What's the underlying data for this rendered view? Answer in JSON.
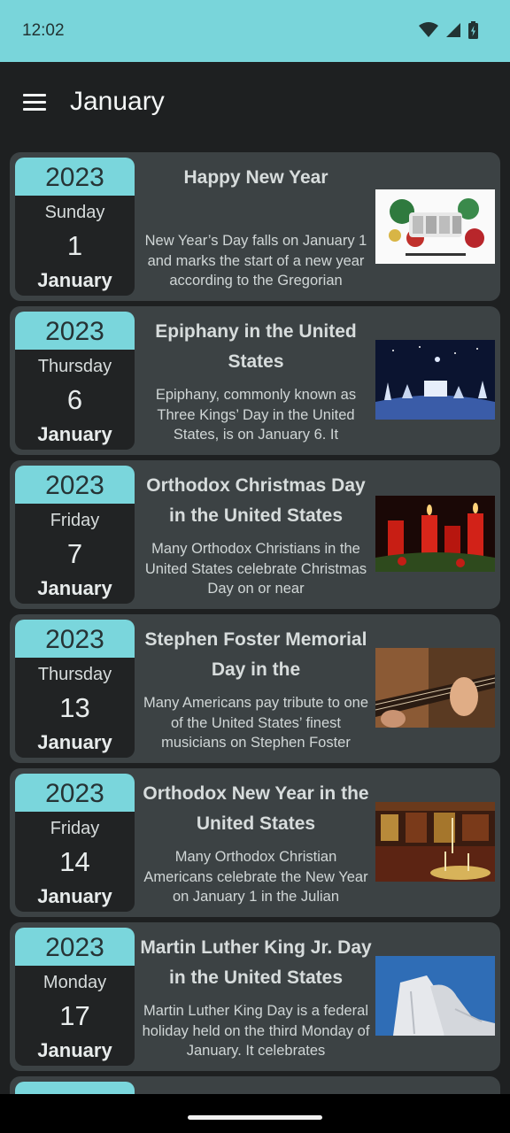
{
  "status_bar": {
    "time": "12:02",
    "icons": [
      "wifi-icon",
      "signal-icon",
      "battery-icon"
    ]
  },
  "app_bar": {
    "title": "January",
    "menu_icon": "hamburger-menu-icon"
  },
  "colors": {
    "accent": "#7ad6dc",
    "card_bg": "#3c4244",
    "background": "#1e2021"
  },
  "events": [
    {
      "year": "2023",
      "weekday": "Sunday",
      "day": "1",
      "month": "January",
      "title": "Happy New Year",
      "description": "New Year’s Day falls on January 1 and marks the start of a new year according to the Gregorian",
      "image": "new-year-2022-image"
    },
    {
      "year": "2023",
      "weekday": "Thursday",
      "day": "6",
      "month": "January",
      "title": "Epiphany in the United States",
      "description": "Epiphany, commonly known as Three Kings’ Day in the United States, is on January 6. It",
      "image": "nativity-scene-image"
    },
    {
      "year": "2023",
      "weekday": "Friday",
      "day": "7",
      "month": "January",
      "title": "Orthodox Christmas Day in the United States",
      "description": "Many Orthodox Christians in the United States celebrate Christmas Day on or near",
      "image": "christmas-candles-image"
    },
    {
      "year": "2023",
      "weekday": "Thursday",
      "day": "13",
      "month": "January",
      "title": "Stephen Foster Memorial Day in the",
      "description": "Many Americans pay tribute to one of the United States’ finest musicians on Stephen Foster",
      "image": "guitar-image"
    },
    {
      "year": "2023",
      "weekday": "Friday",
      "day": "14",
      "month": "January",
      "title": "Orthodox New Year in the United States",
      "description": "Many Orthodox Christian Americans celebrate the New Year on January 1 in the Julian",
      "image": "church-interior-image"
    },
    {
      "year": "2023",
      "weekday": "Monday",
      "day": "17",
      "month": "January",
      "title": "Martin Luther King Jr. Day in the United States",
      "description": "Martin Luther King Day is a federal holiday held on the third Monday of January. It celebrates",
      "image": "mlk-memorial-image"
    }
  ]
}
